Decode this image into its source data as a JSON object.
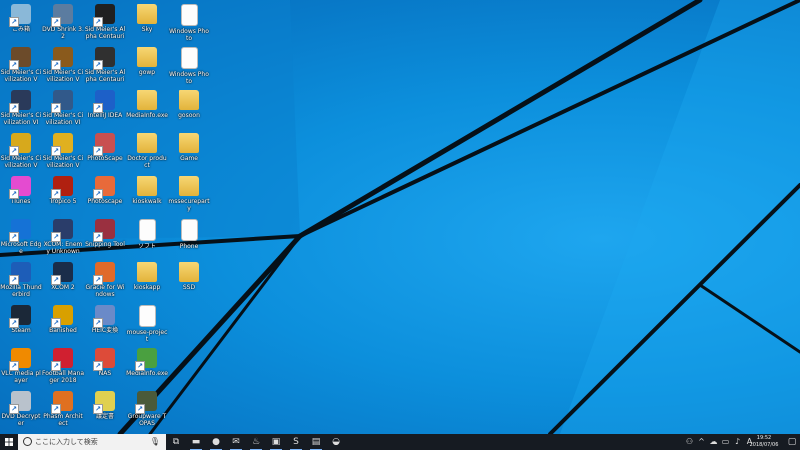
{
  "desktop_icons": [
    {
      "label": "ごみ箱",
      "icon": "recycle-bin-icon",
      "color": "#8ab8d8",
      "type": "app"
    },
    {
      "label": "Sid Meier's Civilization V",
      "icon": "civ5-icon",
      "color": "#6c4b2a",
      "type": "app"
    },
    {
      "label": "Sid Meier's Civilization VI",
      "icon": "civ6-icon",
      "color": "#2a3a5a",
      "type": "app"
    },
    {
      "label": "Sid Meier's Civilization V",
      "icon": "civ5-v-icon",
      "color": "#d7a91c",
      "type": "app"
    },
    {
      "label": "iTunes",
      "icon": "itunes-icon",
      "color": "#e44bd0",
      "type": "app"
    },
    {
      "label": "Microsoft Edge",
      "icon": "edge-icon",
      "color": "#1572d6",
      "type": "app"
    },
    {
      "label": "Mozilla Thunderbird",
      "icon": "thunderbird-icon",
      "color": "#1d5db8",
      "type": "app"
    },
    {
      "label": "Steam",
      "icon": "steam-icon",
      "color": "#1b2838",
      "type": "app"
    },
    {
      "label": "VLC media player",
      "icon": "vlc-icon",
      "color": "#f08a00",
      "type": "app"
    },
    {
      "label": "DVD Decrypter",
      "icon": "dvd-icon",
      "color": "#b9c2cc",
      "type": "app"
    },
    {
      "label": "DVD Shrink 3.2",
      "icon": "dvd-shrink-icon",
      "color": "#5b7ca0",
      "type": "app"
    },
    {
      "label": "Sid Meier's Civilization V",
      "icon": "civ5-gold-icon",
      "color": "#8a5a1c",
      "type": "app"
    },
    {
      "label": "Sid Meier's Civilization VI",
      "icon": "civ6-blue-icon",
      "color": "#31598a",
      "type": "app"
    },
    {
      "label": "Sid Meier's Civilization V",
      "icon": "civ5-yellow-icon",
      "color": "#e0b020",
      "type": "app"
    },
    {
      "label": "Tropico 5",
      "icon": "tropico-icon",
      "color": "#b02010",
      "type": "app"
    },
    {
      "label": "XCOM: Enemy Unknown",
      "icon": "xcom-icon",
      "color": "#2a3d6a",
      "type": "app"
    },
    {
      "label": "XCOM 2",
      "icon": "xcom2-icon",
      "color": "#1a2d4a",
      "type": "app"
    },
    {
      "label": "Banished",
      "icon": "banished-icon",
      "color": "#d8a000",
      "type": "app"
    },
    {
      "label": "Football Manager 2018",
      "icon": "fm-icon",
      "color": "#d02030",
      "type": "app"
    },
    {
      "label": "Phasm Architect",
      "icon": "architect-icon",
      "color": "#e07020",
      "type": "app"
    },
    {
      "label": "Sid Meier's Alpha Centauri",
      "icon": "alpha-centauri-icon",
      "color": "#202020",
      "type": "app"
    },
    {
      "label": "Sid Meier's Alpha Centauri",
      "icon": "alpha-centauri-2-icon",
      "color": "#303030",
      "type": "app"
    },
    {
      "label": "IntelliJ IDEA",
      "icon": "intellij-icon",
      "color": "#1d60c8",
      "type": "app"
    },
    {
      "label": "PhotoScape",
      "icon": "photoscape-icon",
      "color": "#c85050",
      "type": "app"
    },
    {
      "label": "Photoscape",
      "icon": "photoscape-2-icon",
      "color": "#e86a3a",
      "type": "app"
    },
    {
      "label": "Snipping Tool",
      "icon": "snipping-tool-icon",
      "color": "#9a3040",
      "type": "app"
    },
    {
      "label": "Gracie for Windows",
      "icon": "gracie-icon",
      "color": "#e06a2a",
      "type": "app"
    },
    {
      "label": "HEIC変換",
      "icon": "heic-icon",
      "color": "#6a8ac8",
      "type": "app"
    },
    {
      "label": "NAS",
      "icon": "chrome-icon",
      "color": "#dd4b39",
      "type": "app"
    },
    {
      "label": "議定書",
      "icon": "doc-icon",
      "color": "#e0d050",
      "type": "app"
    },
    {
      "label": "Sky",
      "icon": "folder-icon",
      "color": "#f0c850",
      "type": "folder"
    },
    {
      "label": "gowp",
      "icon": "folder-icon",
      "color": "#f0c850",
      "type": "folder"
    },
    {
      "label": "MediaInfo.exe",
      "icon": "folder-icon",
      "color": "#f0c850",
      "type": "folder"
    },
    {
      "label": "Doctor product",
      "icon": "folder-icon",
      "color": "#f0c850",
      "type": "folder"
    },
    {
      "label": "kioskwalk",
      "icon": "folder-icon",
      "color": "#f0c850",
      "type": "folder"
    },
    {
      "label": "ソフト",
      "icon": "file-icon",
      "color": "#ffffff",
      "type": "file"
    },
    {
      "label": "kioskapp",
      "icon": "folder-icon",
      "color": "#f0c850",
      "type": "folder"
    },
    {
      "label": "mouse-project",
      "icon": "file-icon",
      "color": "#ffffff",
      "type": "file"
    },
    {
      "label": "MediaInfo.exe",
      "icon": "mediainfo-icon",
      "color": "#4aa040",
      "type": "app"
    },
    {
      "label": "Groupware TOPAS",
      "icon": "topas-icon",
      "color": "#4a5a3a",
      "type": "app"
    },
    {
      "label": "Windows Photo",
      "icon": "photo-icon",
      "color": "#9ad0f0",
      "type": "file"
    },
    {
      "label": "Windows Photo",
      "icon": "photo-2-icon",
      "color": "#9ad0f0",
      "type": "file"
    },
    {
      "label": "gosoon",
      "icon": "folder-icon",
      "color": "#f0c850",
      "type": "folder"
    },
    {
      "label": "Game",
      "icon": "folder-icon",
      "color": "#f0c850",
      "type": "folder"
    },
    {
      "label": "mssecureparty",
      "icon": "folder-icon",
      "color": "#f0c850",
      "type": "folder"
    },
    {
      "label": "Phone",
      "icon": "phone-icon",
      "color": "#e0e0e0",
      "type": "file"
    },
    {
      "label": "SSD",
      "icon": "folder-icon",
      "color": "#f0c850",
      "type": "folder"
    }
  ],
  "taskbar": {
    "search_placeholder": "ここに入力して検索",
    "pinned": [
      {
        "name": "task-view-icon",
        "glyph": "⧉"
      },
      {
        "name": "file-explorer-icon",
        "glyph": "▬"
      },
      {
        "name": "chrome-icon",
        "glyph": "●"
      },
      {
        "name": "mail-icon",
        "glyph": "✉"
      },
      {
        "name": "steam-icon",
        "glyph": "♨"
      },
      {
        "name": "store-icon",
        "glyph": "▣"
      },
      {
        "name": "skype-icon",
        "glyph": "S"
      },
      {
        "name": "notepad-icon",
        "glyph": "▤"
      },
      {
        "name": "pc-icon",
        "glyph": "◒"
      }
    ],
    "tray": [
      {
        "name": "people-icon",
        "glyph": "⚇"
      },
      {
        "name": "chevron-up-icon",
        "glyph": "^"
      },
      {
        "name": "onedrive-icon",
        "glyph": "☁"
      },
      {
        "name": "network-icon",
        "glyph": "▭"
      },
      {
        "name": "volume-icon",
        "glyph": "♪"
      },
      {
        "name": "ime-icon",
        "glyph": "A"
      }
    ],
    "time": "19:52",
    "date": "2018/07/06"
  }
}
